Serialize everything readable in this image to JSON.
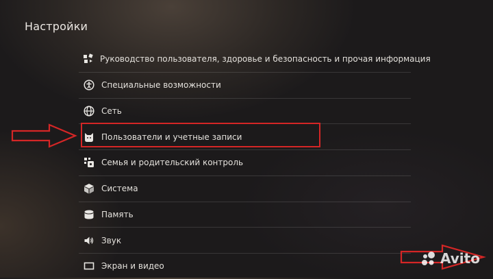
{
  "page": {
    "title": "Настройки"
  },
  "menu": {
    "items": [
      {
        "label": "Руководство пользователя, здоровье и безопасность и прочая информация",
        "icon": "guide-icon"
      },
      {
        "label": "Специальные возможности",
        "icon": "accessibility-icon"
      },
      {
        "label": "Сеть",
        "icon": "globe-icon"
      },
      {
        "label": "Пользователи и учетные записи",
        "icon": "user-cat-icon"
      },
      {
        "label": "Семья и родительский контроль",
        "icon": "family-icon"
      },
      {
        "label": "Система",
        "icon": "cube-icon"
      },
      {
        "label": "Память",
        "icon": "storage-icon"
      },
      {
        "label": "Звук",
        "icon": "speaker-icon"
      },
      {
        "label": "Экран и видео",
        "icon": "display-icon"
      }
    ],
    "highlighted_index": 3
  },
  "annotations": {
    "highlight_color": "#d52626"
  },
  "watermark": {
    "text": "Avito"
  }
}
